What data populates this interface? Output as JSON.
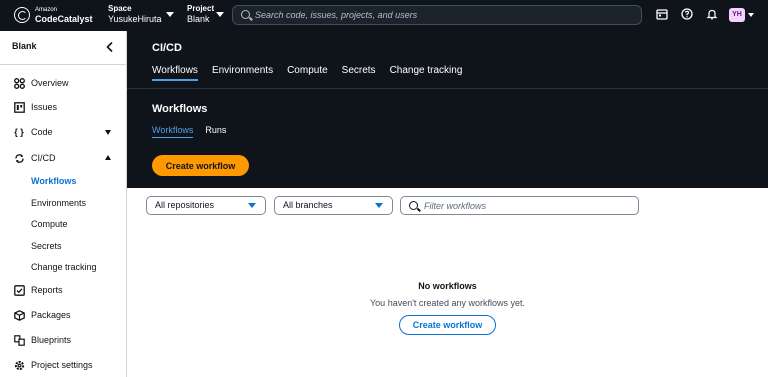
{
  "topbar": {
    "logo_small": "Amazon",
    "logo_big": "CodeCatalyst",
    "space_label": "Space",
    "space_value": "YusukeHiruta",
    "project_label": "Project",
    "project_value": "Blank",
    "search_placeholder": "Search code, issues, projects, and users",
    "avatar_initials": "YH"
  },
  "sidebar": {
    "title": "Blank",
    "items": [
      {
        "label": "Overview",
        "icon": "overview-icon"
      },
      {
        "label": "Issues",
        "icon": "issues-icon"
      },
      {
        "label": "Code",
        "icon": "code-icon"
      },
      {
        "label": "CI/CD",
        "icon": "cicd-icon"
      },
      {
        "label": "Reports",
        "icon": "reports-icon"
      },
      {
        "label": "Packages",
        "icon": "packages-icon"
      },
      {
        "label": "Blueprints",
        "icon": "blueprints-icon"
      },
      {
        "label": "Project settings",
        "icon": "settings-icon"
      }
    ],
    "cicd_subitems": [
      "Workflows",
      "Environments",
      "Compute",
      "Secrets",
      "Change tracking"
    ]
  },
  "main": {
    "title": "CI/CD",
    "tabs": [
      "Workflows",
      "Environments",
      "Compute",
      "Secrets",
      "Change tracking"
    ],
    "section_title": "Workflows",
    "sub_tabs": [
      "Workflows",
      "Runs"
    ],
    "create_button": "Create workflow",
    "repo_select": "All repositories",
    "branch_select": "All branches",
    "filter_placeholder": "Filter workflows",
    "empty_title": "No workflows",
    "empty_desc": "You haven't created any workflows yet.",
    "empty_button": "Create workflow"
  },
  "colors": {
    "header_bg": "#0f141a",
    "accent": "#0972d3",
    "primary_button": "#ff9900",
    "tab_underline": "#539fe5"
  }
}
